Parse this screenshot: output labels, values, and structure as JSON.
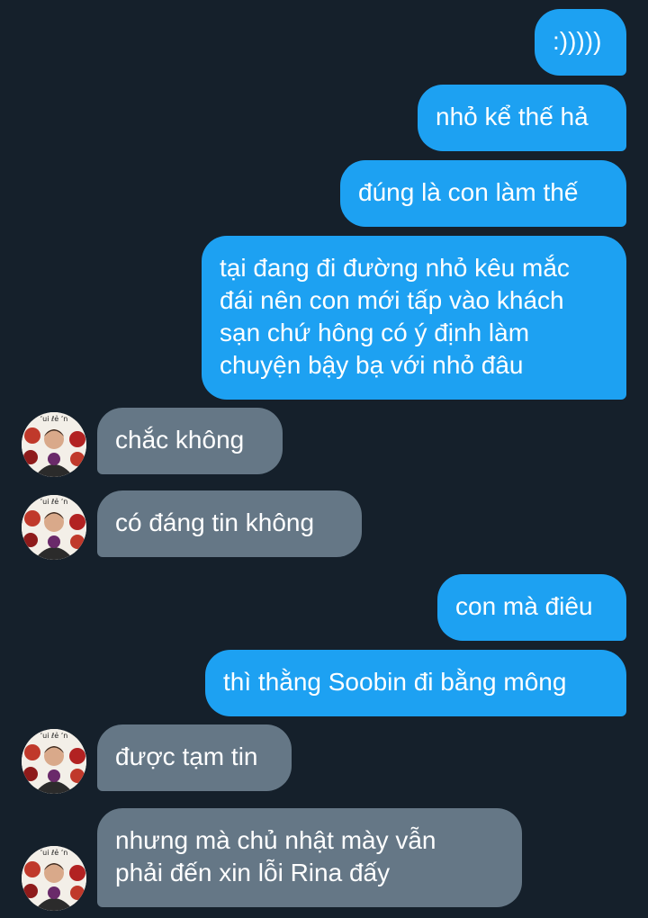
{
  "messages": [
    {
      "direction": "outgoing",
      "lines": [
        ":)))))"
      ]
    },
    {
      "direction": "outgoing",
      "lines": [
        "nhỏ kể thế hả"
      ]
    },
    {
      "direction": "outgoing",
      "lines": [
        "đúng là con làm thế"
      ]
    },
    {
      "direction": "outgoing",
      "lines": [
        "tại đang đi đường nhỏ kêu mắc",
        "đái nên con mới tấp vào khách",
        "sạn chứ hông có ý định làm",
        "chuyện bậy bạ với nhỏ đâu"
      ]
    },
    {
      "direction": "incoming",
      "lines": [
        "chắc không"
      ]
    },
    {
      "direction": "incoming",
      "lines": [
        "có đáng tin không"
      ]
    },
    {
      "direction": "outgoing",
      "lines": [
        "con mà điêu"
      ]
    },
    {
      "direction": "outgoing",
      "lines": [
        "thì thằng Soobin đi bằng mông"
      ]
    },
    {
      "direction": "incoming",
      "lines": [
        "được tạm tin"
      ]
    },
    {
      "direction": "incoming",
      "lines": [
        "nhưng mà chủ nhật mày vẫn",
        "phải đến xin lỗi Rina đấy"
      ]
    }
  ],
  "colors": {
    "background": "#15202b",
    "outgoing_bubble": "#1da1f2",
    "incoming_bubble": "#657786"
  },
  "avatar_icon": "contact-avatar-icon"
}
